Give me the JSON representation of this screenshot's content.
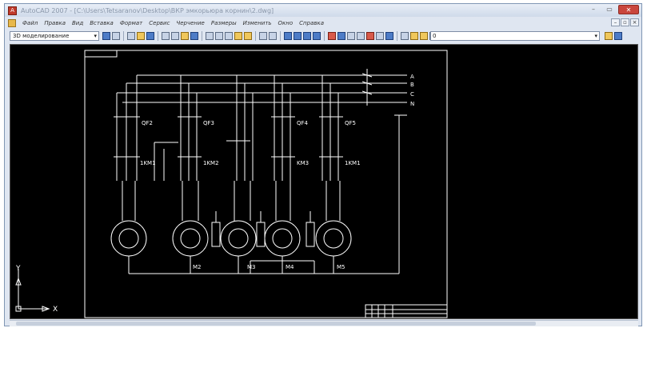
{
  "window": {
    "title": "AutoCAD 2007 - [C:\\Users\\Tetsaranov\\Desktop\\ВКР эмкорьюра корнин\\2.dwg]",
    "app_icon_label": "A"
  },
  "menu": {
    "items": [
      "Файл",
      "Правка",
      "Вид",
      "Вставка",
      "Формат",
      "Сервис",
      "Черчение",
      "Размеры",
      "Изменить",
      "Окно",
      "Справка"
    ]
  },
  "toolbar": {
    "workspace": "3D моделирование",
    "layer": "0"
  },
  "drawing": {
    "bus_labels": [
      "A",
      "B",
      "C",
      "N"
    ],
    "ucs_y_label": "Y",
    "ucs_x_label": "X",
    "breaker_labels": [
      "QF2",
      "QF3",
      "QF4",
      "QF5"
    ],
    "contactor_labels": [
      "1KM1",
      "1KM2",
      "KM3",
      "1KM1"
    ],
    "motor_labels": [
      "M2",
      "M3",
      "M4",
      "M5"
    ],
    "colors": {
      "background": "#000000",
      "lines": "#ffffff"
    }
  }
}
